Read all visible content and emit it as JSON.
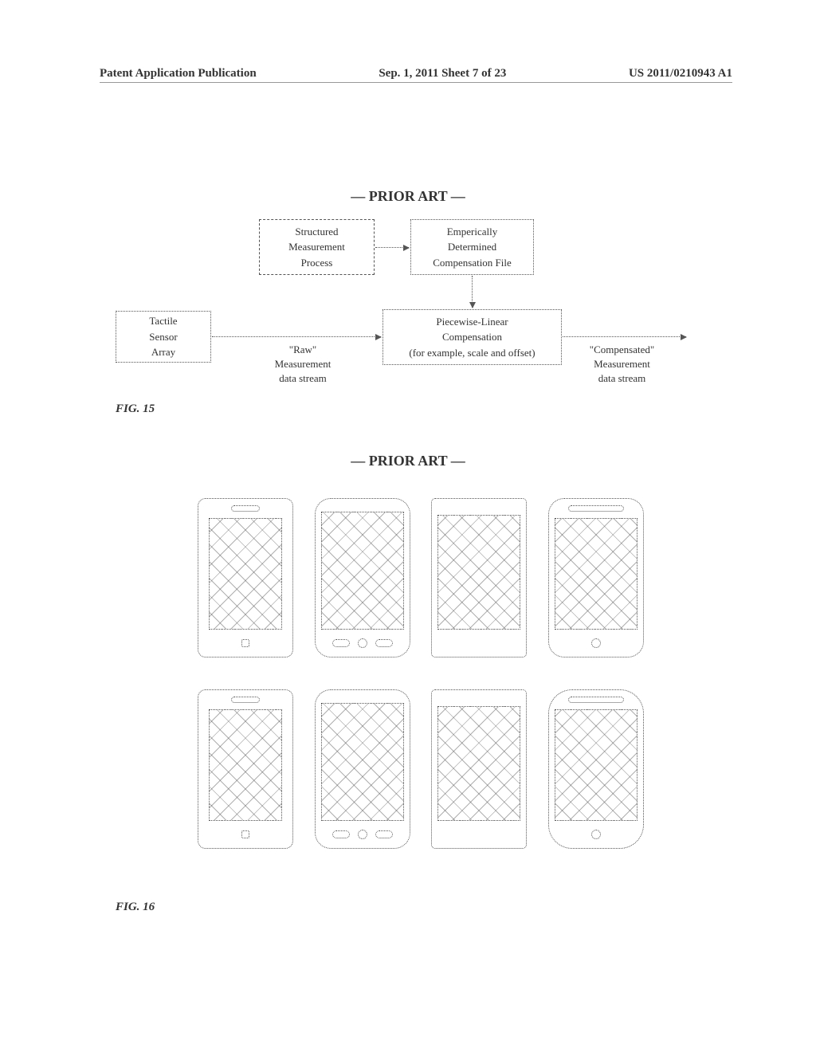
{
  "header": {
    "left": "Patent Application Publication",
    "center": "Sep. 1, 2011  Sheet 7 of 23",
    "right": "US 2011/0210943 A1"
  },
  "priorArt": "— PRIOR ART —",
  "fig15": {
    "label": "FIG. 15",
    "boxes": {
      "structured": "Structured\nMeasurement\nProcess",
      "compFile": "Emperically\nDetermined\nCompensation File",
      "sensor": "Tactile\nSensor\nArray",
      "piecewise": "Piecewise-Linear\nCompensation\n(for example, scale and offset)"
    },
    "labels": {
      "raw": "\"Raw\"\nMeasurement\ndata stream",
      "comp": "\"Compensated\"\nMeasurement\ndata stream"
    }
  },
  "fig16": {
    "label": "FIG. 16"
  }
}
